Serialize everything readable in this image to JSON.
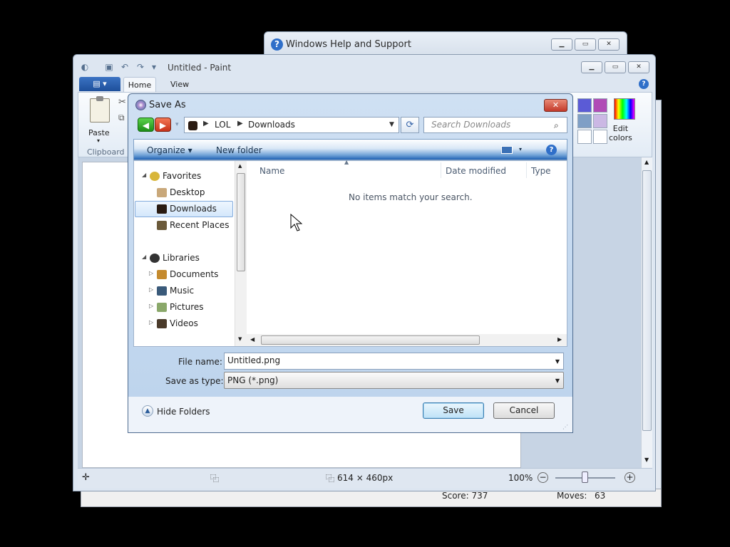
{
  "help_window": {
    "title": "Windows Help and Support"
  },
  "paint": {
    "title": "Untitled - Paint",
    "tabs": {
      "home": "Home",
      "view": "View"
    },
    "paste_label": "Paste",
    "clipboard_label": "Clipboard",
    "edit_colors_line1": "Edit",
    "edit_colors_line2": "colors",
    "status": {
      "dimensions": "614 × 460px",
      "zoom": "100%"
    },
    "swatches": [
      "#5b5bd6",
      "#b04bb6",
      "#7f9fc6",
      "#cbb8e4",
      "#ffffff",
      "#ffffff"
    ]
  },
  "background_status": {
    "score": "Score: 737",
    "moves_label": "Moves:",
    "moves_value": "63"
  },
  "save_dialog": {
    "title": "Save As",
    "breadcrumb": [
      "LOL",
      "Downloads"
    ],
    "search_placeholder": "Search Downloads",
    "commands": {
      "organize": "Organize ▾",
      "new_folder": "New folder"
    },
    "nav": {
      "favorites": "Favorites",
      "desktop": "Desktop",
      "downloads": "Downloads",
      "recent": "Recent Places",
      "libraries": "Libraries",
      "documents": "Documents",
      "music": "Music",
      "pictures": "Pictures",
      "videos": "Videos"
    },
    "columns": {
      "name": "Name",
      "date_modified": "Date modified",
      "type": "Type"
    },
    "empty_message": "No items match your search.",
    "file_name_label": "File name:",
    "file_name_value": "Untitled.png",
    "save_type_label": "Save as type:",
    "save_type_value": "PNG (*.png)",
    "hide_folders": "Hide Folders",
    "save_button": "Save",
    "cancel_button": "Cancel"
  }
}
